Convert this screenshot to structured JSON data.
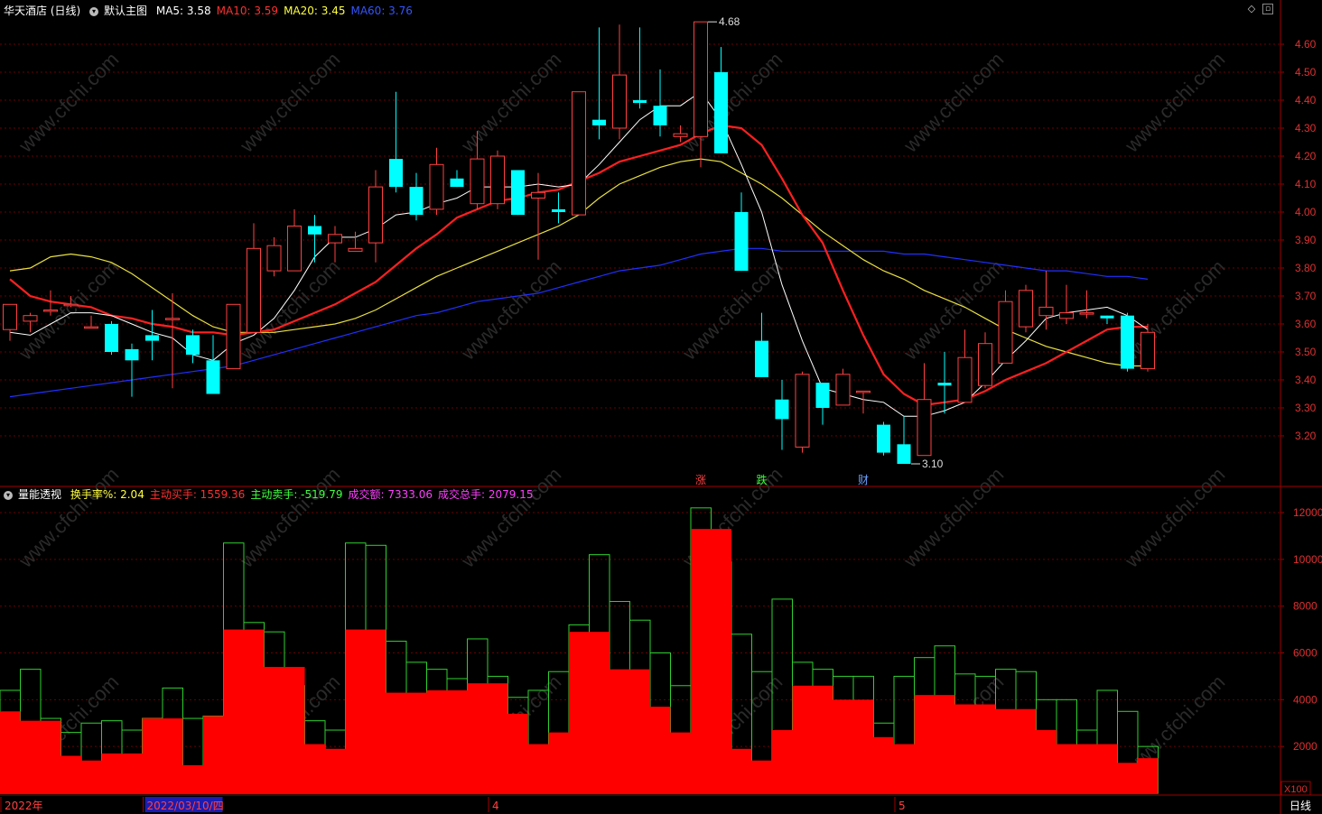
{
  "top_header": {
    "stock": "华天酒店 (日线)",
    "template": "默认主图",
    "ma": [
      {
        "label": "MA5: ",
        "value": "3.58",
        "color": "#ffffff"
      },
      {
        "label": "MA10: ",
        "value": "3.59",
        "color": "#ff3030"
      },
      {
        "label": "MA20: ",
        "value": "3.45",
        "color": "#ffff40"
      },
      {
        "label": "MA60: ",
        "value": "3.76",
        "color": "#3355ff"
      }
    ]
  },
  "bottom_header": {
    "title": "量能透视",
    "items": [
      {
        "label": "换手率%: ",
        "value": "2.04",
        "color": "#ffff40"
      },
      {
        "label": "主动买手: ",
        "value": "1559.36",
        "color": "#ff3030"
      },
      {
        "label": "主动卖手: ",
        "value": "-519.79",
        "color": "#40ff40"
      },
      {
        "label": "成交额: ",
        "value": "7333.06",
        "color": "#ff40ff"
      },
      {
        "label": "成交总手: ",
        "value": "2079.15",
        "color": "#ff40ff"
      }
    ]
  },
  "x_labels": [
    {
      "index": 0,
      "text": "2022年"
    },
    {
      "index": 7,
      "text": "2022/03/10/四"
    },
    {
      "index": 24,
      "text": "4"
    },
    {
      "index": 44,
      "text": "5"
    }
  ],
  "bottom_right_label": "日线",
  "unit_label": "X100",
  "watermark": "www.cfchi.com",
  "chart_data": [
    {
      "type": "candlestick",
      "ylim": [
        3.08,
        4.7
      ],
      "y_ticks": [
        3.2,
        3.3,
        3.4,
        3.5,
        3.6,
        3.7,
        3.8,
        3.9,
        4.0,
        4.1,
        4.2,
        4.3,
        4.4,
        4.5,
        4.6
      ],
      "candles": [
        [
          3.58,
          3.67,
          3.54,
          3.67
        ],
        [
          3.61,
          3.63,
          3.57,
          3.64
        ],
        [
          3.65,
          3.65,
          3.63,
          3.72
        ],
        [
          3.67,
          3.67,
          3.66,
          3.7
        ],
        [
          3.59,
          3.59,
          3.59,
          3.63
        ],
        [
          3.6,
          3.5,
          3.49,
          3.61
        ],
        [
          3.51,
          3.47,
          3.34,
          3.53
        ],
        [
          3.56,
          3.54,
          3.47,
          3.65
        ],
        [
          3.62,
          3.62,
          3.37,
          3.71
        ],
        [
          3.56,
          3.49,
          3.46,
          3.58
        ],
        [
          3.47,
          3.35,
          3.35,
          3.56
        ],
        [
          3.44,
          3.67,
          3.44,
          3.67
        ],
        [
          3.57,
          3.87,
          3.57,
          3.96
        ],
        [
          3.79,
          3.88,
          3.77,
          3.91
        ],
        [
          3.79,
          3.95,
          3.79,
          4.01
        ],
        [
          3.95,
          3.92,
          3.82,
          3.99
        ],
        [
          3.89,
          3.92,
          3.82,
          3.95
        ],
        [
          3.86,
          3.87,
          3.86,
          3.93
        ],
        [
          3.89,
          4.09,
          3.82,
          4.15
        ],
        [
          4.19,
          4.09,
          4.07,
          4.43
        ],
        [
          4.09,
          3.99,
          3.97,
          4.14
        ],
        [
          4.01,
          4.17,
          3.99,
          4.23
        ],
        [
          4.12,
          4.09,
          4.09,
          4.15
        ],
        [
          4.03,
          4.19,
          4.01,
          4.29
        ],
        [
          4.03,
          4.2,
          4.01,
          4.22
        ],
        [
          4.15,
          3.99,
          3.99,
          4.15
        ],
        [
          4.05,
          4.07,
          3.83,
          4.14
        ],
        [
          4.01,
          4.0,
          3.96,
          4.07
        ],
        [
          3.99,
          4.43,
          3.99,
          4.43
        ],
        [
          4.33,
          4.31,
          4.26,
          4.66
        ],
        [
          4.3,
          4.49,
          4.26,
          4.67
        ],
        [
          4.4,
          4.39,
          4.37,
          4.66
        ],
        [
          4.38,
          4.31,
          4.27,
          4.51
        ],
        [
          4.27,
          4.28,
          4.25,
          4.31
        ],
        [
          4.27,
          4.68,
          4.16,
          4.68
        ],
        [
          4.5,
          4.21,
          4.21,
          4.59
        ],
        [
          4.0,
          3.79,
          3.79,
          4.07
        ],
        [
          3.54,
          3.41,
          3.41,
          3.64
        ],
        [
          3.33,
          3.26,
          3.15,
          3.4
        ],
        [
          3.16,
          3.42,
          3.14,
          3.43
        ],
        [
          3.39,
          3.3,
          3.24,
          3.39
        ],
        [
          3.31,
          3.42,
          3.31,
          3.44
        ],
        [
          3.36,
          3.36,
          3.28,
          3.36
        ],
        [
          3.24,
          3.14,
          3.13,
          3.25
        ],
        [
          3.17,
          3.1,
          3.1,
          3.27
        ],
        [
          3.13,
          3.33,
          3.13,
          3.46
        ],
        [
          3.39,
          3.38,
          3.28,
          3.5
        ],
        [
          3.32,
          3.48,
          3.32,
          3.58
        ],
        [
          3.38,
          3.53,
          3.37,
          3.57
        ],
        [
          3.46,
          3.68,
          3.46,
          3.72
        ],
        [
          3.59,
          3.72,
          3.57,
          3.74
        ],
        [
          3.63,
          3.66,
          3.58,
          3.79
        ],
        [
          3.62,
          3.64,
          3.6,
          3.74
        ],
        [
          3.64,
          3.64,
          3.62,
          3.72
        ],
        [
          3.63,
          3.62,
          3.6,
          3.63
        ],
        [
          3.63,
          3.44,
          3.43,
          3.64
        ],
        [
          3.44,
          3.57,
          3.43,
          3.6
        ]
      ],
      "ma5": [
        3.57,
        3.56,
        3.6,
        3.64,
        3.64,
        3.63,
        3.6,
        3.57,
        3.55,
        3.49,
        3.47,
        3.53,
        3.56,
        3.62,
        3.72,
        3.84,
        3.91,
        3.91,
        3.94,
        3.99,
        4.0,
        4.03,
        4.05,
        4.09,
        4.09,
        4.09,
        4.1,
        4.09,
        4.1,
        4.17,
        4.25,
        4.33,
        4.38,
        4.38,
        4.43,
        4.33,
        4.17,
        4.0,
        3.74,
        3.54,
        3.37,
        3.35,
        3.33,
        3.32,
        3.27,
        3.27,
        3.29,
        3.32,
        3.39,
        3.47,
        3.54,
        3.62,
        3.64,
        3.65,
        3.66,
        3.63,
        3.58
      ],
      "ma10": [
        3.76,
        3.7,
        3.68,
        3.67,
        3.66,
        3.63,
        3.62,
        3.6,
        3.59,
        3.57,
        3.57,
        3.56,
        3.57,
        3.58,
        3.61,
        3.64,
        3.67,
        3.71,
        3.75,
        3.81,
        3.87,
        3.92,
        3.98,
        4.01,
        4.04,
        4.05,
        4.07,
        4.08,
        4.11,
        4.14,
        4.18,
        4.2,
        4.22,
        4.24,
        4.28,
        4.31,
        4.3,
        4.24,
        4.12,
        3.99,
        3.89,
        3.72,
        3.56,
        3.42,
        3.35,
        3.31,
        3.32,
        3.33,
        3.36,
        3.4,
        3.43,
        3.46,
        3.5,
        3.54,
        3.58,
        3.59,
        3.59
      ],
      "ma20": [
        3.79,
        3.8,
        3.84,
        3.85,
        3.84,
        3.82,
        3.78,
        3.73,
        3.68,
        3.63,
        3.59,
        3.57,
        3.57,
        3.57,
        3.58,
        3.59,
        3.6,
        3.62,
        3.65,
        3.69,
        3.73,
        3.77,
        3.8,
        3.83,
        3.86,
        3.89,
        3.92,
        3.95,
        3.99,
        4.05,
        4.1,
        4.13,
        4.16,
        4.18,
        4.19,
        4.18,
        4.14,
        4.1,
        4.05,
        3.99,
        3.93,
        3.88,
        3.83,
        3.79,
        3.76,
        3.72,
        3.69,
        3.66,
        3.62,
        3.58,
        3.55,
        3.52,
        3.5,
        3.48,
        3.46,
        3.45,
        3.45
      ],
      "ma60": [
        3.34,
        3.35,
        3.36,
        3.37,
        3.38,
        3.39,
        3.4,
        3.41,
        3.42,
        3.43,
        3.44,
        3.45,
        3.47,
        3.49,
        3.51,
        3.53,
        3.55,
        3.57,
        3.59,
        3.61,
        3.63,
        3.64,
        3.66,
        3.68,
        3.69,
        3.7,
        3.71,
        3.73,
        3.75,
        3.77,
        3.79,
        3.8,
        3.81,
        3.83,
        3.85,
        3.86,
        3.87,
        3.87,
        3.86,
        3.86,
        3.86,
        3.86,
        3.86,
        3.86,
        3.85,
        3.85,
        3.84,
        3.83,
        3.82,
        3.81,
        3.8,
        3.79,
        3.79,
        3.78,
        3.77,
        3.77,
        3.76
      ],
      "annotations": [
        {
          "index": 34,
          "value": 4.68,
          "text": "4.68"
        },
        {
          "index": 44,
          "value": 3.1,
          "text": "3.10"
        }
      ],
      "markers": [
        {
          "index": 34,
          "text": "涨",
          "color": "#ff4040"
        },
        {
          "index": 37,
          "text": "跌",
          "color": "#40ff40"
        },
        {
          "index": 42,
          "text": "财",
          "color": "#6aa0ff"
        }
      ]
    },
    {
      "type": "bar",
      "ylim": [
        0,
        12800
      ],
      "y_ticks": [
        2000,
        4000,
        6000,
        8000,
        10000,
        12000
      ],
      "red_values": [
        3500,
        3100,
        3100,
        1600,
        1400,
        1700,
        1700,
        3200,
        3200,
        1200,
        3300,
        7000,
        7000,
        5400,
        5400,
        2100,
        1900,
        7000,
        7000,
        4300,
        4300,
        4400,
        4400,
        4700,
        4700,
        3400,
        2100,
        2600,
        6900,
        6900,
        5300,
        5300,
        3700,
        2600,
        11300,
        11300,
        1900,
        1400,
        2700,
        4600,
        4600,
        4000,
        4000,
        2400,
        2100,
        4200,
        4200,
        3800,
        3800,
        3600,
        3600,
        2700,
        2100,
        2100,
        2100,
        1300,
        1500
      ],
      "outline_values": [
        4400,
        5300,
        3200,
        2600,
        3000,
        3100,
        2700,
        3200,
        4500,
        3200,
        3300,
        10700,
        7300,
        6900,
        4600,
        3100,
        2700,
        10700,
        10600,
        6500,
        5600,
        5300,
        4900,
        6600,
        5000,
        4100,
        4400,
        5200,
        7200,
        10200,
        8200,
        7400,
        6000,
        4600,
        12200,
        9900,
        6800,
        5200,
        8300,
        5600,
        5300,
        5000,
        5000,
        3000,
        5000,
        5800,
        6300,
        5100,
        5000,
        5300,
        5200,
        4000,
        4000,
        2700,
        4400,
        3500,
        2000
      ]
    }
  ]
}
